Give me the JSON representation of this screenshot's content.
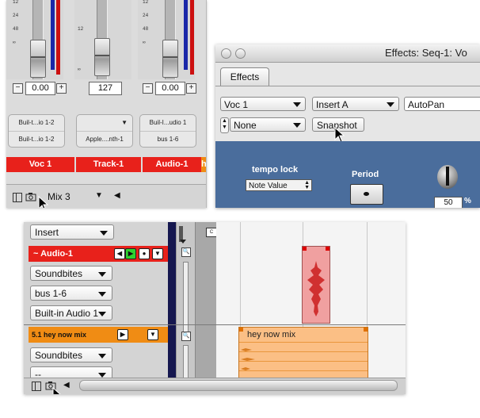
{
  "mixer": {
    "meter_ticks": [
      "12",
      "24",
      "48",
      "∞"
    ],
    "channels": [
      {
        "gain": "0.00",
        "input": "Buil-t...io 1-2",
        "output": "Buil-t...io 1-2",
        "name": "Voc 1"
      },
      {
        "gain": "127",
        "input": "",
        "output": "Apple....nth-1",
        "name": "Track-1"
      },
      {
        "gain": "0.00",
        "input": "Buil-I...udio 1",
        "output": "bus 1-6",
        "name": "Audio-1"
      }
    ],
    "partial_channel_name": "h",
    "minus_label": "−",
    "plus_label": "+",
    "mix_name": "Mix 3",
    "colors": {
      "name_bar": "#e8211b",
      "meter": "#1a27a8",
      "clip": "#cc1010"
    }
  },
  "effects_window": {
    "title": "Effects: Seq-1: Vo",
    "tab": "Effects",
    "track_select": "Voc 1",
    "insert_select": "Insert A",
    "plugin_name": "AutoPan",
    "preset_select": "None",
    "snapshot_button": "Snapshot",
    "plugin": {
      "tempo_lock_label": "tempo lock",
      "tempo_lock_value": "Note Value",
      "period_label": "Period",
      "knob_value": "50",
      "knob_unit": "%",
      "background": "#4a6d9c"
    }
  },
  "sequence": {
    "insert_select": "Insert",
    "audio_track": {
      "name": "~ Audio-1",
      "effect_select": "Soundbites",
      "output_select": "bus 1-6",
      "input_select": "Built-in Audio 1",
      "color": "#e8211b"
    },
    "mix_track": {
      "name": "5.1 hey now mix",
      "effect_select": "Soundbites",
      "output_select": "--",
      "color": "#f08c14"
    },
    "clip_mix_label": "hey now mix",
    "clip_audio_label": "",
    "colors": {
      "audio_clip": "#f0a0a0",
      "mix_clip": "#fbbf85"
    }
  }
}
